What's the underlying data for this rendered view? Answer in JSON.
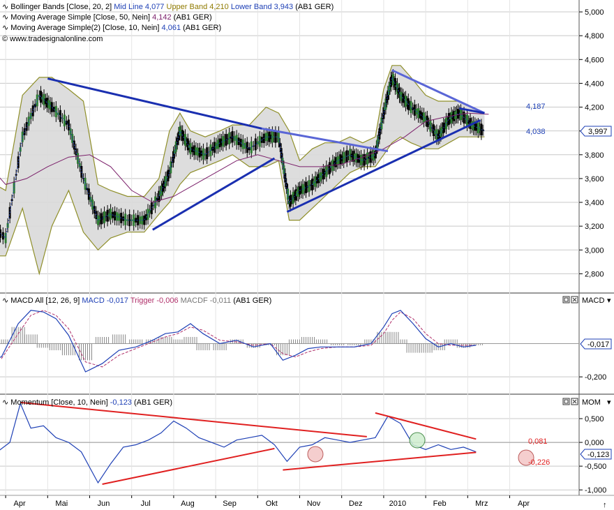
{
  "colors": {
    "price_up": "#2e7d32",
    "price_down": "#000000",
    "band": "#8f8f2a",
    "band_fill": "#d9d9d9",
    "mid_line": "#1d3fb5",
    "sma50": "#7b1f6a",
    "sma10": "#1d3fb5",
    "trend_blue": "#1a2fb0",
    "trend_blue_light": "#5a66d6",
    "trend_red": "#e02020",
    "macd": "#1d3fb5",
    "trigger": "#b0306a",
    "hist": "#888888",
    "grid": "#c8c8c8",
    "lower_band_text": "#1d3fb5",
    "upper_band_text": "#8f7a00"
  },
  "legend": {
    "bb_prefix": "Bollinger Bands [Close, 20, 2]",
    "bb_mid": "Mid Line 4,077",
    "bb_upper": "Upper Band 4,210",
    "bb_lower": "Lower Band 3,943",
    "bb_suffix": "(AB1 GER)",
    "sma50_prefix": "Moving Average Simple [Close, 50, Nein]",
    "sma50_val": "4,142",
    "sma50_suffix": "(AB1 GER)",
    "sma10_prefix": "Moving Average Simple(2) [Close, 10, Nein]",
    "sma10_val": "4,061",
    "sma10_suffix": "(AB1 GER)",
    "copyright": "© www.tradesignalonline.com",
    "macd_prefix": "MACD All [12, 26, 9]",
    "macd_macd": "MACD -0,017",
    "macd_trigger": "Trigger -0,006",
    "macd_macdf": "MACDF -0,011",
    "macd_suffix": "(AB1 GER)",
    "mom_prefix": "Momentum [Close, 10, Nein]",
    "mom_val": "-0,123",
    "mom_suffix": "(AB1 GER)"
  },
  "right_panel": {
    "macd_title": "MACD",
    "mom_title": "MOM",
    "price_tag": "3,997",
    "macd_tag": "-0,017",
    "mom_tag": "-0,123"
  },
  "annotations": {
    "price_upper": "4,187",
    "price_lower": "4,038",
    "mom_upper": "0,081",
    "mom_lower": "-0,226"
  },
  "chart_data": [
    {
      "type": "line",
      "panel": "price",
      "y_axis_ticks": [
        "5,000",
        "4,800",
        "4,600",
        "4,400",
        "4,200",
        "4,000",
        "3,800",
        "3,600",
        "3,400",
        "3,200",
        "3,000",
        "2,800"
      ],
      "ylim": [
        2.65,
        5.1
      ],
      "x_ticks": [
        "Apr",
        "Mai",
        "Jun",
        "Jul",
        "Aug",
        "Sep",
        "Okt",
        "Nov",
        "Dez",
        "2010",
        "Feb",
        "Mrz",
        "Apr"
      ],
      "x_tick_positions": [
        0.5,
        1.5,
        2.5,
        3.5,
        4.5,
        5.5,
        6.5,
        7.5,
        8.5,
        9.5,
        10.5,
        11.5,
        12.5
      ],
      "series": [
        {
          "x": [
            0.0,
            0.5,
            0.9,
            1.3,
            1.6,
            2.0,
            2.35,
            2.7,
            3.0,
            3.4,
            3.8,
            4.15,
            4.4,
            4.65,
            4.9,
            5.25,
            5.6,
            5.9,
            6.3,
            6.7,
            7.0,
            7.25,
            7.5,
            7.8,
            8.1,
            8.4,
            8.7,
            9.0,
            9.3,
            9.5,
            9.7,
            9.9,
            10.15,
            10.5,
            10.8,
            11.05,
            11.3,
            11.6,
            11.9
          ],
          "values": [
            3.25,
            3.1,
            3.95,
            4.3,
            4.2,
            4.05,
            3.6,
            3.25,
            3.3,
            3.25,
            3.25,
            3.45,
            3.65,
            4.0,
            3.85,
            3.8,
            3.9,
            3.95,
            3.85,
            3.95,
            3.95,
            3.4,
            3.5,
            3.55,
            3.65,
            3.75,
            3.8,
            3.75,
            3.8,
            4.15,
            4.45,
            4.3,
            4.2,
            4.1,
            3.95,
            4.1,
            4.15,
            4.05,
            4.0
          ]
        }
      ],
      "upper_band": {
        "x": [
          0.0,
          0.5,
          0.9,
          1.3,
          1.6,
          2.0,
          2.35,
          2.7,
          3.0,
          3.4,
          3.8,
          4.15,
          4.4,
          4.65,
          4.9,
          5.25,
          5.6,
          5.9,
          6.3,
          6.7,
          7.0,
          7.25,
          7.5,
          7.8,
          8.1,
          8.4,
          8.7,
          9.0,
          9.3,
          9.5,
          9.7,
          9.9,
          10.15,
          10.5,
          10.8,
          11.05,
          11.3,
          11.6,
          11.9
        ],
        "values": [
          3.6,
          3.5,
          4.3,
          4.45,
          4.45,
          4.35,
          4.25,
          3.55,
          3.5,
          3.45,
          3.45,
          3.6,
          4.0,
          4.15,
          4.0,
          3.95,
          4.0,
          4.05,
          4.05,
          4.2,
          4.15,
          4.0,
          3.75,
          3.85,
          3.9,
          3.9,
          3.95,
          3.9,
          3.95,
          4.35,
          4.55,
          4.55,
          4.45,
          4.3,
          4.25,
          4.25,
          4.25,
          4.2,
          4.15
        ]
      },
      "lower_band": {
        "x": [
          0.0,
          0.5,
          0.9,
          1.3,
          1.6,
          2.0,
          2.35,
          2.7,
          3.0,
          3.4,
          3.8,
          4.15,
          4.4,
          4.65,
          4.9,
          5.25,
          5.6,
          5.9,
          6.3,
          6.7,
          7.0,
          7.25,
          7.5,
          7.8,
          8.1,
          8.4,
          8.7,
          9.0,
          9.3,
          9.5,
          9.7,
          9.9,
          10.15,
          10.5,
          10.8,
          11.05,
          11.3,
          11.6,
          11.9
        ],
        "values": [
          2.95,
          2.95,
          3.35,
          2.8,
          3.2,
          3.5,
          3.15,
          3.0,
          3.1,
          3.15,
          3.15,
          3.3,
          3.4,
          3.55,
          3.65,
          3.7,
          3.75,
          3.8,
          3.7,
          3.7,
          3.75,
          3.25,
          3.25,
          3.35,
          3.45,
          3.55,
          3.65,
          3.7,
          3.7,
          3.8,
          3.9,
          3.95,
          3.9,
          3.85,
          3.85,
          3.9,
          3.95,
          3.95,
          3.95
        ]
      },
      "sma50": {
        "x": [
          0.0,
          0.5,
          1.0,
          1.5,
          2.0,
          2.5,
          3.0,
          3.5,
          4.0,
          4.5,
          5.0,
          5.5,
          6.0,
          6.5,
          7.0,
          7.5,
          8.0,
          8.5,
          9.0,
          9.5,
          10.0,
          10.5,
          11.0,
          11.5,
          12.0
        ],
        "values": [
          3.75,
          3.55,
          3.6,
          3.7,
          3.78,
          3.8,
          3.7,
          3.5,
          3.4,
          3.45,
          3.55,
          3.65,
          3.75,
          3.8,
          3.75,
          3.7,
          3.7,
          3.72,
          3.78,
          3.85,
          3.95,
          4.08,
          4.12,
          4.15,
          4.14
        ]
      },
      "trendlines": [
        {
          "x": [
            1.5,
            6.6
          ],
          "values": [
            4.44,
            4.02
          ],
          "color": "trend_blue"
        },
        {
          "x": [
            6.6,
            9.6
          ],
          "values": [
            4.02,
            3.83
          ],
          "color": "trend_blue_light"
        },
        {
          "x": [
            4.0,
            6.9
          ],
          "values": [
            3.17,
            3.77
          ],
          "color": "trend_blue"
        },
        {
          "x": [
            7.2,
            11.8
          ],
          "values": [
            3.32,
            4.09
          ],
          "color": "trend_blue"
        },
        {
          "x": [
            9.7,
            11.9
          ],
          "values": [
            4.51,
            4.15
          ],
          "color": "trend_blue_light"
        },
        {
          "x": [
            11.3,
            11.9
          ],
          "values": [
            4.19,
            4.15
          ],
          "color": "trend_blue"
        }
      ]
    },
    {
      "type": "line",
      "panel": "macd",
      "y_axis_ticks": [
        "-0,200"
      ],
      "ylim": [
        -0.3,
        0.3
      ],
      "series": [
        {
          "name": "MACD",
          "x": [
            0.0,
            0.4,
            0.8,
            1.1,
            1.4,
            1.7,
            2.0,
            2.4,
            2.8,
            3.2,
            3.6,
            4.0,
            4.3,
            4.6,
            4.9,
            5.2,
            5.6,
            6.0,
            6.4,
            6.8,
            7.1,
            7.4,
            7.7,
            8.0,
            8.4,
            8.8,
            9.2,
            9.5,
            9.7,
            9.9,
            10.2,
            10.5,
            10.8,
            11.1,
            11.4,
            11.7
          ],
          "values": [
            -0.1,
            -0.08,
            0.12,
            0.2,
            0.19,
            0.15,
            0.05,
            -0.17,
            -0.12,
            -0.04,
            -0.02,
            0.02,
            0.06,
            0.07,
            0.12,
            0.06,
            0.0,
            0.02,
            -0.02,
            0.0,
            -0.1,
            -0.07,
            -0.03,
            -0.02,
            -0.02,
            -0.02,
            0.0,
            0.1,
            0.18,
            0.2,
            0.12,
            0.03,
            -0.02,
            0.0,
            -0.02,
            -0.01
          ]
        },
        {
          "name": "Trigger",
          "x": [
            0.0,
            0.4,
            0.8,
            1.1,
            1.4,
            1.7,
            2.0,
            2.4,
            2.8,
            3.2,
            3.6,
            4.0,
            4.3,
            4.6,
            4.9,
            5.2,
            5.6,
            6.0,
            6.4,
            6.8,
            7.1,
            7.4,
            7.7,
            8.0,
            8.4,
            8.8,
            9.2,
            9.5,
            9.7,
            9.9,
            10.2,
            10.5,
            10.8,
            11.1,
            11.4,
            11.7
          ],
          "values": [
            -0.09,
            -0.09,
            0.06,
            0.17,
            0.2,
            0.17,
            0.09,
            -0.11,
            -0.14,
            -0.07,
            -0.03,
            0.01,
            0.04,
            0.06,
            0.1,
            0.08,
            0.02,
            0.01,
            -0.01,
            0.0,
            -0.06,
            -0.08,
            -0.05,
            -0.03,
            -0.02,
            -0.02,
            -0.01,
            0.06,
            0.14,
            0.19,
            0.15,
            0.06,
            0.0,
            -0.01,
            -0.01,
            -0.01
          ]
        }
      ]
    },
    {
      "type": "line",
      "panel": "momentum",
      "y_axis_ticks": [
        "0,500",
        "0,000",
        "-0,500",
        "-1,000"
      ],
      "ylim": [
        -1.1,
        1.0
      ],
      "series": [
        {
          "x": [
            0.0,
            0.3,
            0.6,
            0.85,
            1.1,
            1.4,
            1.7,
            2.0,
            2.3,
            2.7,
            3.0,
            3.3,
            3.6,
            3.9,
            4.2,
            4.5,
            4.8,
            5.1,
            5.4,
            5.7,
            6.0,
            6.3,
            6.6,
            6.9,
            7.2,
            7.5,
            7.8,
            8.1,
            8.4,
            8.7,
            9.0,
            9.3,
            9.6,
            9.9,
            10.2,
            10.5,
            10.8,
            11.1,
            11.4,
            11.7
          ],
          "values": [
            -0.15,
            -0.2,
            0.0,
            0.82,
            0.3,
            0.35,
            0.1,
            0.0,
            -0.2,
            -0.85,
            -0.45,
            -0.1,
            -0.05,
            0.05,
            0.2,
            0.45,
            0.3,
            0.1,
            0.0,
            -0.1,
            0.05,
            0.1,
            0.15,
            -0.05,
            -0.4,
            -0.1,
            -0.05,
            0.1,
            0.05,
            0.0,
            0.05,
            0.1,
            0.55,
            0.4,
            -0.05,
            -0.15,
            -0.05,
            -0.15,
            -0.1,
            -0.2
          ]
        }
      ],
      "trendlines": [
        {
          "x": [
            0.85,
            9.1
          ],
          "values": [
            0.84,
            0.12
          ],
          "color": "trend_red"
        },
        {
          "x": [
            2.8,
            6.9
          ],
          "values": [
            -0.88,
            -0.13
          ],
          "color": "trend_red"
        },
        {
          "x": [
            7.1,
            11.7
          ],
          "values": [
            -0.58,
            -0.21
          ],
          "color": "trend_red"
        },
        {
          "x": [
            9.3,
            11.7
          ],
          "values": [
            0.62,
            0.07
          ],
          "color": "trend_red"
        }
      ]
    }
  ]
}
